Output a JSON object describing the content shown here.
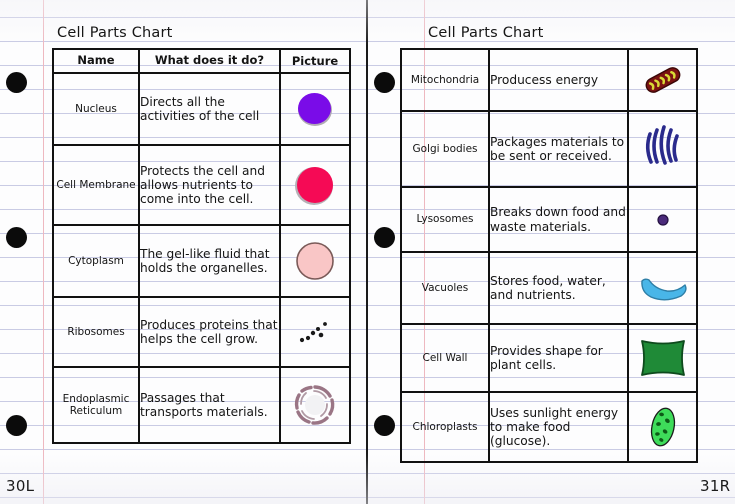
{
  "pages": {
    "left": {
      "label": "30L",
      "title": "Cell Parts Chart",
      "headers": {
        "name": "Name",
        "description": "What does it do?",
        "picture": "Picture"
      },
      "rows": [
        {
          "name": "Nucleus",
          "description": "Directs all the activities of the cell",
          "picture": "nucleus-icon"
        },
        {
          "name": "Cell Membrane",
          "description": "Protects the cell and allows nutrients to come into the cell.",
          "picture": "cell-membrane-icon"
        },
        {
          "name": "Cytoplasm",
          "description": "The gel-like fluid that holds the organelles.",
          "picture": "cytoplasm-icon"
        },
        {
          "name": "Ribosomes",
          "description": "Produces proteins that helps the cell grow.",
          "picture": "ribosomes-icon"
        },
        {
          "name": "Endoplasmic Reticulum",
          "description": "Passages that transports materials.",
          "picture": "endoplasmic-reticulum-icon"
        }
      ]
    },
    "right": {
      "label": "31R",
      "title": "Cell Parts Chart",
      "rows": [
        {
          "name": "Mitochondria",
          "description": "Producess energy",
          "picture": "mitochondria-icon"
        },
        {
          "name": "Golgi bodies",
          "description": "Packages materials to be sent or received.",
          "picture": "golgi-bodies-icon"
        },
        {
          "name": "Lysosomes",
          "description": "Breaks down food and waste materials.",
          "picture": "lysosomes-icon"
        },
        {
          "name": "Vacuoles",
          "description": "Stores food, water, and nutrients.",
          "picture": "vacuoles-icon"
        },
        {
          "name": "Cell Wall",
          "description": "Provides shape for plant cells.",
          "picture": "cell-wall-icon"
        },
        {
          "name": "Chloroplasts",
          "description": "Uses sunlight energy to make food (glucose).",
          "picture": "chloroplasts-icon"
        }
      ]
    }
  },
  "colors": {
    "nucleus": "#7a0ce8",
    "cell_membrane": "#f50a55",
    "cytoplasm": "#f9c6c6",
    "cytoplasm_outline": "#7a5a58",
    "ribosomes": "#1a1a1a",
    "endoplasmic_reticulum": "#9a7585",
    "mitochondria": "#7a1212",
    "mitochondria_cristae": "#d9d935",
    "golgi_bodies": "#2a2a8c",
    "lysosomes": "#4a2a7a",
    "vacuoles": "#49b6e8",
    "cell_wall": "#1f8a37",
    "chloroplasts": "#3edc5a",
    "chloroplasts_spots": "#0d5a17",
    "rule_line": "#c9cbe4",
    "margin_line": "#eeb8c0",
    "ink": "#141414"
  }
}
